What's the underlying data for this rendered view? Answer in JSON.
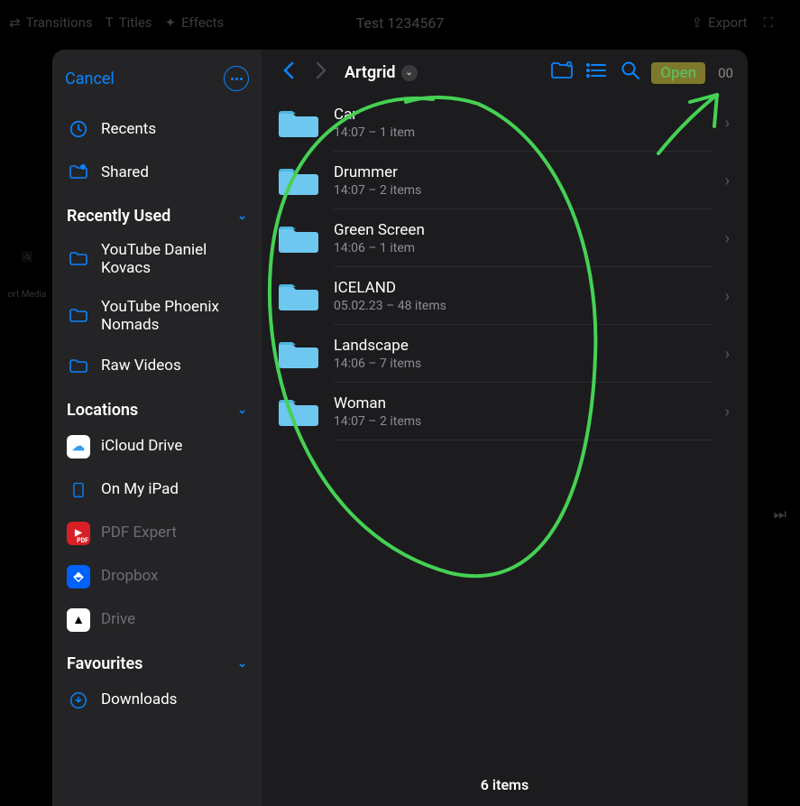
{
  "background": {
    "transitions": "Transitions",
    "titles": "Titles",
    "effects": "Effects",
    "project_title": "Test 1234567",
    "export": "Export",
    "import_media": "ort Media"
  },
  "sheet": {
    "cancel": "Cancel",
    "top_items": [
      {
        "icon": "clock-icon",
        "label": "Recents"
      },
      {
        "icon": "folder-shared-icon",
        "label": "Shared"
      }
    ],
    "sections": {
      "recent": {
        "title": "Recently Used",
        "items": [
          {
            "icon": "folder-icon",
            "label": "YouTube Daniel Kovacs"
          },
          {
            "icon": "folder-icon",
            "label": "YouTube Phoenix Nomads"
          },
          {
            "icon": "folder-icon",
            "label": "Raw Videos"
          }
        ]
      },
      "locations": {
        "title": "Locations",
        "items": [
          {
            "icon": "icloud",
            "label": "iCloud Drive",
            "dim": false
          },
          {
            "icon": "ipad",
            "label": "On My iPad",
            "dim": false
          },
          {
            "icon": "pdfexp",
            "label": "PDF Expert",
            "dim": true
          },
          {
            "icon": "dropbox",
            "label": "Dropbox",
            "dim": true
          },
          {
            "icon": "gdrive",
            "label": "Drive",
            "dim": true
          }
        ]
      },
      "favourites": {
        "title": "Favourites",
        "items": [
          {
            "icon": "download-icon",
            "label": "Downloads"
          }
        ]
      }
    }
  },
  "main": {
    "breadcrumb": "Artgrid",
    "open_label": "Open",
    "counter_suffix": "00",
    "footer": "6 items",
    "items": [
      {
        "name": "Car",
        "meta": "14:07 – 1 item"
      },
      {
        "name": "Drummer",
        "meta": "14:07 – 2 items"
      },
      {
        "name": "Green Screen",
        "meta": "14:06 – 1 item"
      },
      {
        "name": "ICELAND",
        "meta": "05.02.23 – 48 items"
      },
      {
        "name": "Landscape",
        "meta": "14:06 – 7 items"
      },
      {
        "name": "Woman",
        "meta": "14:07 – 2 items"
      }
    ]
  }
}
